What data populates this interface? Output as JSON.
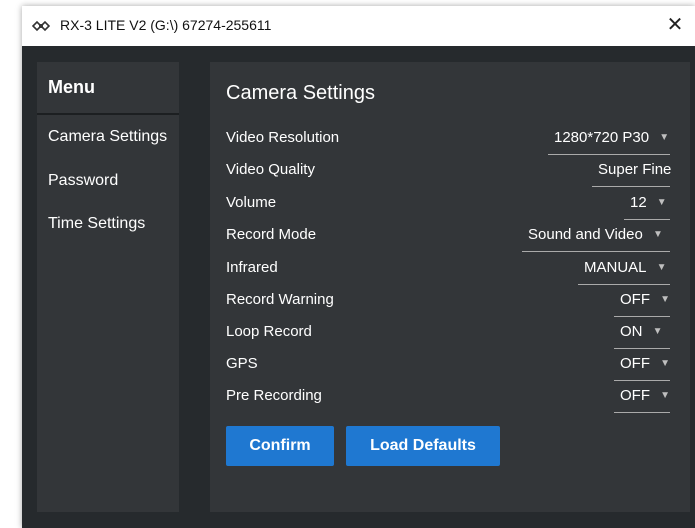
{
  "window": {
    "title": "RX-3 LITE V2 (G:\\)  67274-255611",
    "close_glyph": "✕"
  },
  "sidebar": {
    "title": "Menu",
    "items": [
      {
        "label": "Camera Settings"
      },
      {
        "label": "Password"
      },
      {
        "label": "Time Settings"
      }
    ]
  },
  "main": {
    "title": "Camera Settings",
    "settings": [
      {
        "label": "Video Resolution",
        "value": "1280*720 P30",
        "dropdown": true
      },
      {
        "label": "Video Quality",
        "value": "Super Fine",
        "dropdown": false
      },
      {
        "label": "Volume",
        "value": "12",
        "dropdown": true
      },
      {
        "label": "Record Mode",
        "value": "Sound and Video",
        "dropdown": true
      },
      {
        "label": "Infrared",
        "value": "MANUAL",
        "dropdown": true
      },
      {
        "label": "Record Warning",
        "value": "OFF",
        "dropdown": true
      },
      {
        "label": "Loop Record",
        "value": "ON",
        "dropdown": true
      },
      {
        "label": "GPS",
        "value": "OFF",
        "dropdown": true
      },
      {
        "label": "Pre Recording",
        "value": "OFF",
        "dropdown": true
      }
    ],
    "buttons": {
      "confirm": "Confirm",
      "defaults": "Load Defaults"
    }
  },
  "icons": {
    "app": "app-logo-icon",
    "close": "close-icon",
    "dropdown": "chevron-down-icon"
  },
  "colors": {
    "window_bg": "#262a2d",
    "panel_bg": "#333639",
    "accent": "#1f78d1",
    "text": "#ffffff"
  }
}
